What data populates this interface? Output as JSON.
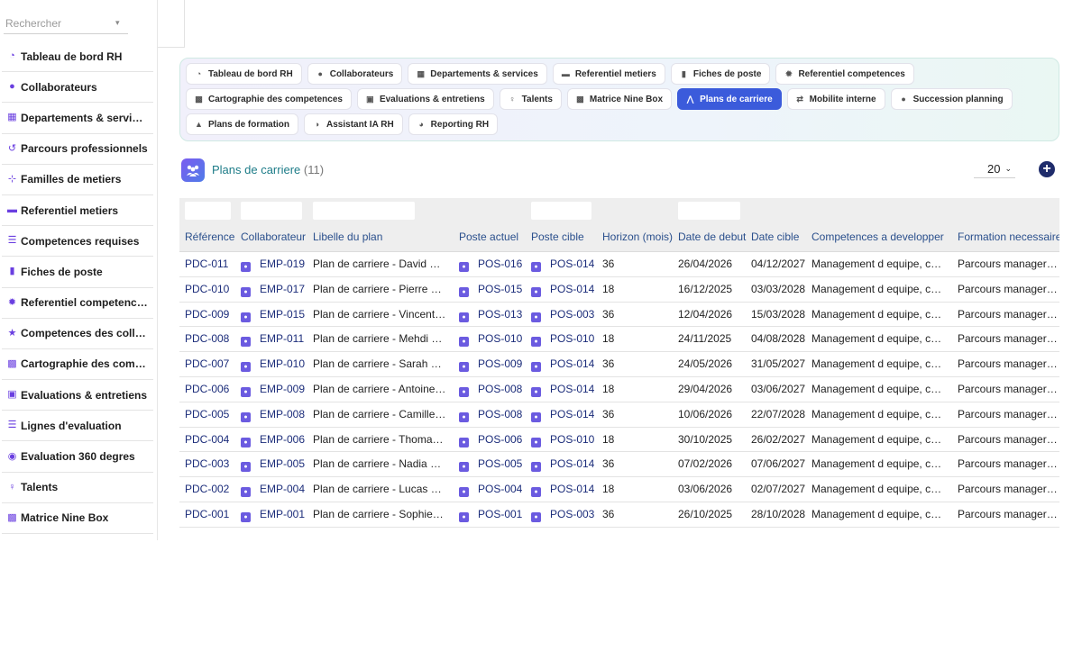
{
  "sidebar": {
    "search": {
      "placeholder": "Rechercher",
      "caret": "▾"
    },
    "items": [
      {
        "label": "Tableau de bord RH",
        "icon": "dashboard-icon",
        "glyph": "◔"
      },
      {
        "label": "Collaborateurs",
        "icon": "user-icon",
        "glyph": "●"
      },
      {
        "label": "Departements & services",
        "icon": "building-icon",
        "glyph": "▦"
      },
      {
        "label": "Parcours professionnels",
        "icon": "history-icon",
        "glyph": "↺"
      },
      {
        "label": "Familles de metiers",
        "icon": "sitemap-icon",
        "glyph": "⊹"
      },
      {
        "label": "Referentiel metiers",
        "icon": "briefcase-icon",
        "glyph": "▬"
      },
      {
        "label": "Competences requises",
        "icon": "list-icon",
        "glyph": "☰"
      },
      {
        "label": "Fiches de poste",
        "icon": "file-icon",
        "glyph": "▮"
      },
      {
        "label": "Referentiel competences",
        "icon": "cog-icon",
        "glyph": "✹"
      },
      {
        "label": "Competences des collaborateurs",
        "icon": "star-icon",
        "glyph": "★"
      },
      {
        "label": "Cartographie des competences",
        "icon": "grid-icon",
        "glyph": "▩"
      },
      {
        "label": "Evaluations & entretiens",
        "icon": "clipboard-icon",
        "glyph": "▣"
      },
      {
        "label": "Lignes d'evaluation",
        "icon": "list-icon",
        "glyph": "☰"
      },
      {
        "label": "Evaluation 360 degres",
        "icon": "comments-icon",
        "glyph": "◉"
      },
      {
        "label": "Talents",
        "icon": "person-icon",
        "glyph": "♀"
      },
      {
        "label": "Matrice Nine Box",
        "icon": "grid-icon",
        "glyph": "▩"
      }
    ]
  },
  "tabs": [
    {
      "label": "Tableau de bord RH",
      "icon": "dashboard-icon",
      "glyph": "◔",
      "active": false
    },
    {
      "label": "Collaborateurs",
      "icon": "user-icon",
      "glyph": "●",
      "active": false
    },
    {
      "label": "Departements & services",
      "icon": "building-icon",
      "glyph": "▦",
      "active": false
    },
    {
      "label": "Referentiel metiers",
      "icon": "briefcase-icon",
      "glyph": "▬",
      "active": false
    },
    {
      "label": "Fiches de poste",
      "icon": "file-icon",
      "glyph": "▮",
      "active": false
    },
    {
      "label": "Referentiel competences",
      "icon": "cog-icon",
      "glyph": "✹",
      "active": false
    },
    {
      "label": "Cartographie des competences",
      "icon": "grid-icon",
      "glyph": "▩",
      "active": false
    },
    {
      "label": "Evaluations & entretiens",
      "icon": "clipboard-icon",
      "glyph": "▣",
      "active": false
    },
    {
      "label": "Talents",
      "icon": "person-icon",
      "glyph": "♀",
      "active": false
    },
    {
      "label": "Matrice Nine Box",
      "icon": "grid-icon",
      "glyph": "▩",
      "active": false
    },
    {
      "label": "Plans de carriere",
      "icon": "road-icon",
      "glyph": "⋀",
      "active": true
    },
    {
      "label": "Mobilite interne",
      "icon": "exchange-icon",
      "glyph": "⇄",
      "active": false
    },
    {
      "label": "Succession planning",
      "icon": "user-tie-icon",
      "glyph": "●",
      "active": false
    },
    {
      "label": "Plans de formation",
      "icon": "graduation-icon",
      "glyph": "▲",
      "active": false
    },
    {
      "label": "Assistant IA RH",
      "icon": "brain-icon",
      "glyph": "◑",
      "active": false
    },
    {
      "label": "Reporting RH",
      "icon": "chart-pie-icon",
      "glyph": "◕",
      "active": false
    }
  ],
  "page": {
    "title": "Plans de carriere",
    "count": "(11)",
    "page_size": "20",
    "page_size_caret": "⌄",
    "add_glyph": "+"
  },
  "table": {
    "columns": [
      "Référence",
      "Collaborateur",
      "Libelle du plan",
      "Poste actuel",
      "Poste cible",
      "Horizon (mois)",
      "Date de debut",
      "Date cible",
      "Competences a developper",
      "Formation necessaire"
    ],
    "rows": [
      [
        "PDC-011",
        "EMP-019",
        "Plan de carriere - David Guerin",
        "POS-016",
        "POS-014",
        "36",
        "26/04/2026",
        "04/12/2027",
        "Management d equipe, communication",
        "Parcours managerial et"
      ],
      [
        "PDC-010",
        "EMP-017",
        "Plan de carriere - Pierre Martin",
        "POS-015",
        "POS-014",
        "18",
        "16/12/2025",
        "03/03/2028",
        "Management d equipe, communication",
        "Parcours managerial et"
      ],
      [
        "PDC-009",
        "EMP-015",
        "Plan de carriere - Vincent Roux",
        "POS-013",
        "POS-003",
        "36",
        "12/04/2026",
        "15/03/2028",
        "Management d equipe, communication",
        "Parcours managerial et"
      ],
      [
        "PDC-008",
        "EMP-011",
        "Plan de carriere - Mehdi Haddad",
        "POS-010",
        "POS-010",
        "18",
        "24/11/2025",
        "04/08/2028",
        "Management d equipe, communication",
        "Parcours managerial et"
      ],
      [
        "PDC-007",
        "EMP-010",
        "Plan de carriere - Sarah Dubois",
        "POS-009",
        "POS-014",
        "36",
        "24/05/2026",
        "31/05/2027",
        "Management d equipe, communication",
        "Parcours managerial et"
      ],
      [
        "PDC-006",
        "EMP-009",
        "Plan de carriere - Antoine Leroy",
        "POS-008",
        "POS-014",
        "18",
        "29/04/2026",
        "03/06/2027",
        "Management d equipe, communication",
        "Parcours managerial et"
      ],
      [
        "PDC-005",
        "EMP-008",
        "Plan de carriere - Camille Robert",
        "POS-008",
        "POS-014",
        "36",
        "10/06/2026",
        "22/07/2028",
        "Management d equipe, communication",
        "Parcours managerial et"
      ],
      [
        "PDC-004",
        "EMP-006",
        "Plan de carriere - Thomas Bernard",
        "POS-006",
        "POS-010",
        "18",
        "30/10/2025",
        "26/02/2027",
        "Management d equipe, communication",
        "Parcours managerial et"
      ],
      [
        "PDC-003",
        "EMP-005",
        "Plan de carriere - Nadia Bouzid",
        "POS-005",
        "POS-014",
        "36",
        "07/02/2026",
        "07/06/2027",
        "Management d equipe, communication",
        "Parcours managerial et"
      ],
      [
        "PDC-002",
        "EMP-004",
        "Plan de carriere - Lucas Perrin",
        "POS-004",
        "POS-014",
        "18",
        "03/06/2026",
        "02/07/2027",
        "Management d equipe, communication",
        "Parcours managerial et"
      ],
      [
        "PDC-001",
        "EMP-001",
        "Plan de carriere - Sophie Martin",
        "POS-001",
        "POS-003",
        "36",
        "26/10/2025",
        "28/10/2028",
        "Management d equipe, communication",
        "Parcours managerial et"
      ]
    ]
  },
  "colors": {
    "accent": "#3b5bdb",
    "icon_purple": "#6a3fe0",
    "link": "#1b2c7a",
    "title_teal": "#1d7c88"
  }
}
